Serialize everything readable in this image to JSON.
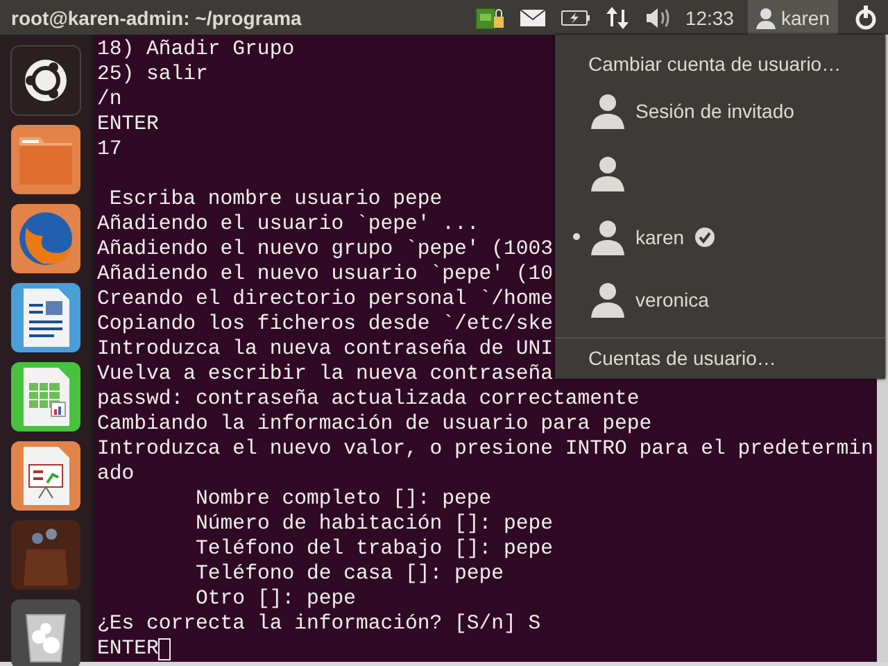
{
  "top_bar": {
    "title": "root@karen-admin: ~/programa",
    "time": "12:33",
    "user": {
      "name": "karen",
      "selected": true
    }
  },
  "terminal": {
    "lines": [
      {
        "kind": "output",
        "text": "18) Añadir Grupo"
      },
      {
        "kind": "output",
        "text": "25) salir"
      },
      {
        "kind": "output",
        "text": "/n"
      },
      {
        "kind": "output",
        "text": "ENTER"
      },
      {
        "kind": "output",
        "text": "17"
      },
      {
        "kind": "blank"
      },
      {
        "kind": "output",
        "text": " Escriba nombre usuario pepe"
      },
      {
        "kind": "output",
        "text": "Añadiendo el usuario `pepe' ..."
      },
      {
        "kind": "output",
        "text": "Añadiendo el nuevo grupo `pepe' (1003"
      },
      {
        "kind": "output",
        "text": "Añadiendo el nuevo usuario `pepe' (10"
      },
      {
        "kind": "output",
        "text": "Creando el directorio personal `/home"
      },
      {
        "kind": "output",
        "text": "Copiando los ficheros desde `/etc/ske"
      },
      {
        "kind": "output",
        "text": "Introduzca la nueva contraseña de UNI"
      },
      {
        "kind": "output",
        "text": "Vuelva a escribir la nueva contraseña"
      },
      {
        "kind": "output",
        "text": "passwd: contraseña actualizada correctamente"
      },
      {
        "kind": "output",
        "text": "Cambiando la información de usuario para pepe"
      },
      {
        "kind": "output",
        "text": "Introduzca el nuevo valor, o presione INTRO para el predetermin"
      },
      {
        "kind": "output",
        "text": "ado"
      },
      {
        "kind": "output",
        "text": "\tNombre completo []: pepe"
      },
      {
        "kind": "output",
        "text": "\tNúmero de habitación []: pepe"
      },
      {
        "kind": "output",
        "text": "\tTeléfono del trabajo []: pepe"
      },
      {
        "kind": "output",
        "text": "\tTeléfono de casa []: pepe"
      },
      {
        "kind": "output",
        "text": "\tOtro []: pepe"
      },
      {
        "kind": "output",
        "text": "¿Es correcta la información? [S/n] S"
      },
      {
        "kind": "output",
        "text": "ENTER",
        "cursor": true
      }
    ]
  },
  "user_menu": {
    "header": "Cambiar cuenta de usuario…",
    "users": [
      {
        "name": "Sesión de invitado",
        "current": false,
        "logged_in": false
      },
      {
        "current": false,
        "logged_in": false
      },
      {
        "name": "karen",
        "current": true,
        "logged_in": true
      },
      {
        "name": "veronica",
        "current": false,
        "logged_in": false
      }
    ],
    "footer": "Cuentas de usuario…"
  }
}
